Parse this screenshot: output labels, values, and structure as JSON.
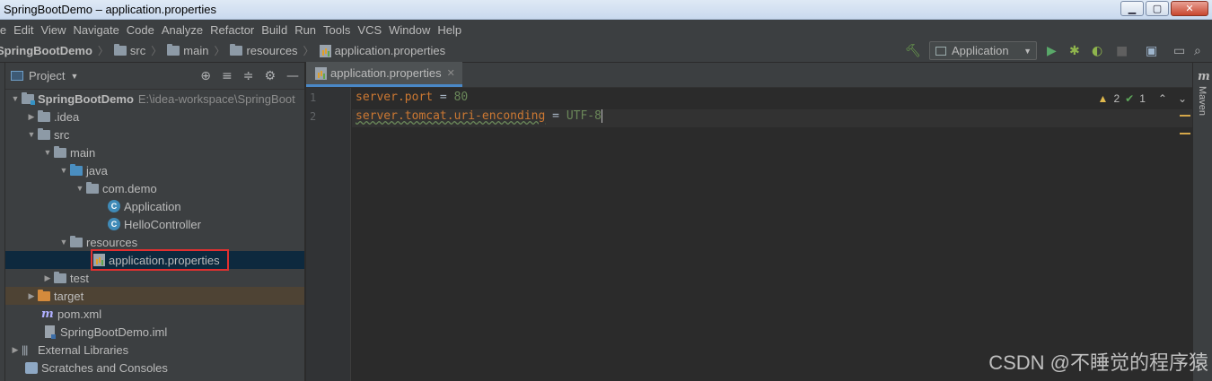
{
  "window": {
    "title": "SpringBootDemo – application.properties"
  },
  "menu": [
    "le",
    "Edit",
    "View",
    "Navigate",
    "Code",
    "Analyze",
    "Refactor",
    "Build",
    "Run",
    "Tools",
    "VCS",
    "Window",
    "Help"
  ],
  "breadcrumb": [
    "SpringBootDemo",
    "src",
    "main",
    "resources",
    "application.properties"
  ],
  "toolbar": {
    "run_config": "Application"
  },
  "project": {
    "title": "Project",
    "tree": [
      {
        "label": "SpringBootDemo",
        "path": "E:\\idea-workspace\\SpringBoot"
      },
      {
        "label": ".idea"
      },
      {
        "label": "src"
      },
      {
        "label": "main"
      },
      {
        "label": "java"
      },
      {
        "label": "com.demo"
      },
      {
        "label": "Application"
      },
      {
        "label": "HelloController"
      },
      {
        "label": "resources"
      },
      {
        "label": "application.properties"
      },
      {
        "label": "test"
      },
      {
        "label": "target"
      },
      {
        "label": "pom.xml"
      },
      {
        "label": "SpringBootDemo.iml"
      },
      {
        "label": "External Libraries"
      },
      {
        "label": "Scratches and Consoles"
      }
    ]
  },
  "editor": {
    "tab": "application.properties",
    "lines": [
      {
        "num": "1",
        "key": "server.port",
        "eq": " = ",
        "value": "80"
      },
      {
        "num": "2",
        "key": "server.tomcat.uri-enconding",
        "eq": " = ",
        "value": "UTF-8"
      }
    ],
    "warnings": "2",
    "weak_warnings": "1"
  },
  "right_stripe": {
    "maven": "Maven",
    "maven_icon_letter": "m"
  },
  "watermark": "CSDN @不睡觉的程序猿"
}
